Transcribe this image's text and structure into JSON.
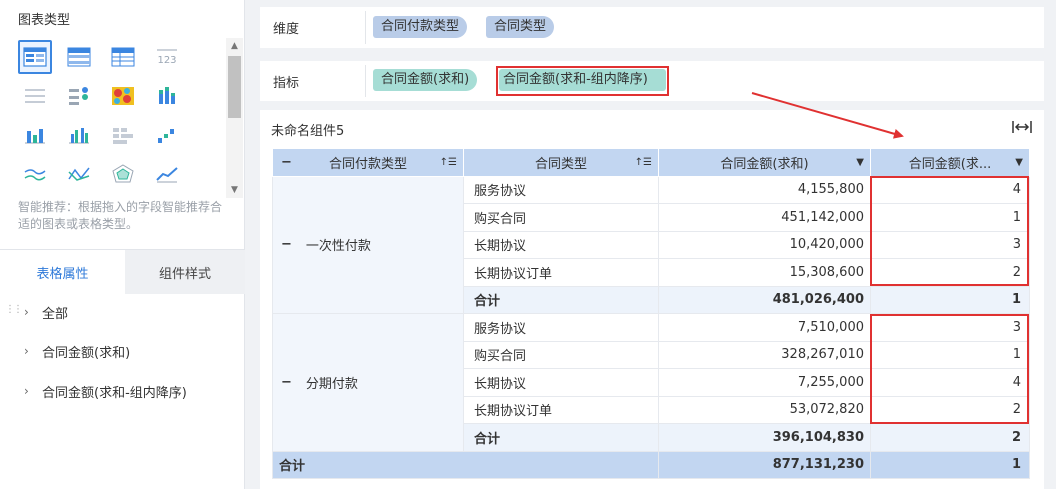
{
  "left_panel": {
    "chart_type_title": "图表类型",
    "hint": "智能推荐：根据拖入的字段智能推荐合适的图表或表格类型。",
    "tabs": [
      "表格属性",
      "组件样式"
    ],
    "properties": [
      "全部",
      "合同金额(求和)",
      "合同金额(求和-组内降序)"
    ]
  },
  "dimension": {
    "label": "维度",
    "chips": [
      "合同付款类型",
      "合同类型"
    ]
  },
  "metric": {
    "label": "指标",
    "chips": [
      "合同金额(求和)",
      "合同金额(求和-组内降序)"
    ]
  },
  "component": {
    "title": "未命名组件5"
  },
  "table": {
    "headers": [
      "合同付款类型",
      "合同类型",
      "合同金额(求和)",
      "合同金额(求..."
    ],
    "groups": [
      {
        "name": "一次性付款",
        "rows": [
          {
            "type": "服务协议",
            "amount": "4,155,800",
            "rank": "4"
          },
          {
            "type": "购买合同",
            "amount": "451,142,000",
            "rank": "1"
          },
          {
            "type": "长期协议",
            "amount": "10,420,000",
            "rank": "3"
          },
          {
            "type": "长期协议订单",
            "amount": "15,308,600",
            "rank": "2"
          }
        ],
        "subtotal": {
          "label": "合计",
          "amount": "481,026,400",
          "rank": "1"
        }
      },
      {
        "name": "分期付款",
        "rows": [
          {
            "type": "服务协议",
            "amount": "7,510,000",
            "rank": "3"
          },
          {
            "type": "购买合同",
            "amount": "328,267,010",
            "rank": "1"
          },
          {
            "type": "长期协议",
            "amount": "7,255,000",
            "rank": "4"
          },
          {
            "type": "长期协议订单",
            "amount": "53,072,820",
            "rank": "2"
          }
        ],
        "subtotal": {
          "label": "合计",
          "amount": "396,104,830",
          "rank": "2"
        }
      }
    ],
    "grand_total": {
      "label": "合计",
      "amount": "877,131,230",
      "rank": "1"
    }
  },
  "icons": {
    "chart_types": [
      "detail-table-icon",
      "group-table-icon",
      "cross-table-icon",
      "kpi-number-icon",
      "list-table-icon",
      "dot-list-icon",
      "heatmap-icon",
      "stacked-bar-icon",
      "column-chart-icon",
      "grouped-column-icon",
      "table-grid-icon",
      "waterfall-icon",
      "multi-line-icon",
      "line-icon",
      "radar-icon",
      "area-line-icon"
    ],
    "fit_width": "fit-width-icon",
    "annotation_color": "#e03131",
    "accent": "#2f7ad9"
  }
}
